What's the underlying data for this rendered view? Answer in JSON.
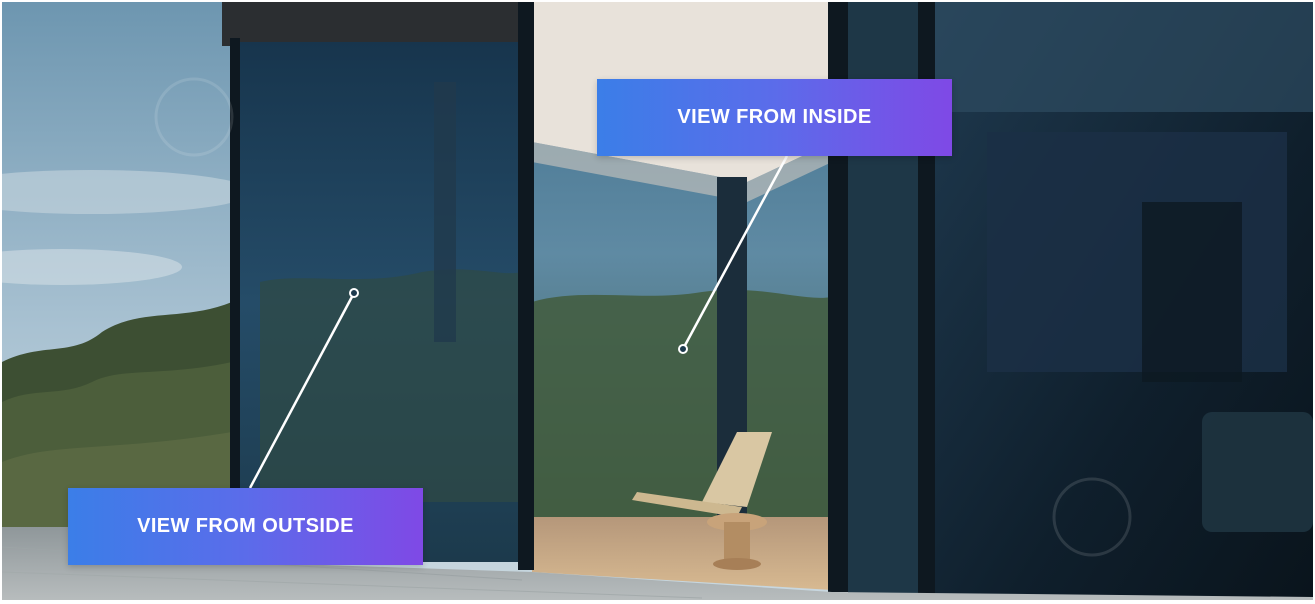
{
  "image": {
    "description_tag": "house-with-tinted-glass-windows",
    "labels": {
      "inside": "VIEW FROM INSIDE",
      "outside": "VIEW FROM OUTSIDE"
    },
    "colors": {
      "label_gradient_start": "#3b7ee8",
      "label_gradient_end": "#7f49e6",
      "label_text": "#ffffff",
      "pointer_line": "#ffffff"
    }
  }
}
